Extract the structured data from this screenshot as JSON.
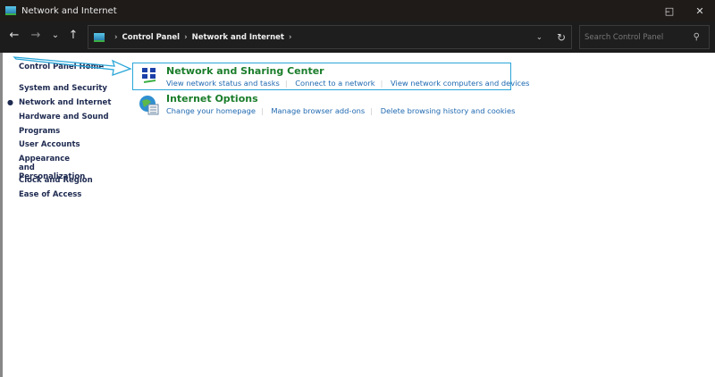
{
  "window": {
    "title": "Network and Internet"
  },
  "address": {
    "crumbs": [
      "Control Panel",
      "Network and Internet"
    ]
  },
  "search": {
    "placeholder": "Search Control Panel"
  },
  "sidebar": {
    "home": "Control Panel Home",
    "items": [
      "System and Security",
      "Network and Internet",
      "Hardware and Sound",
      "Programs",
      "User Accounts",
      "Appearance and Personalization",
      "Clock and Region",
      "Ease of Access"
    ],
    "current": "Network and Internet"
  },
  "categories": [
    {
      "title": "Network and Sharing Center",
      "links": [
        "View network status and tasks",
        "Connect to a network",
        "View network computers and devices"
      ]
    },
    {
      "title": "Internet Options",
      "links": [
        "Change your homepage",
        "Manage browser add-ons",
        "Delete browsing history and cookies"
      ]
    }
  ],
  "colors": {
    "highlight": "#2aa6d8",
    "category_title": "#1a7d2a",
    "link": "#1e68b0"
  }
}
